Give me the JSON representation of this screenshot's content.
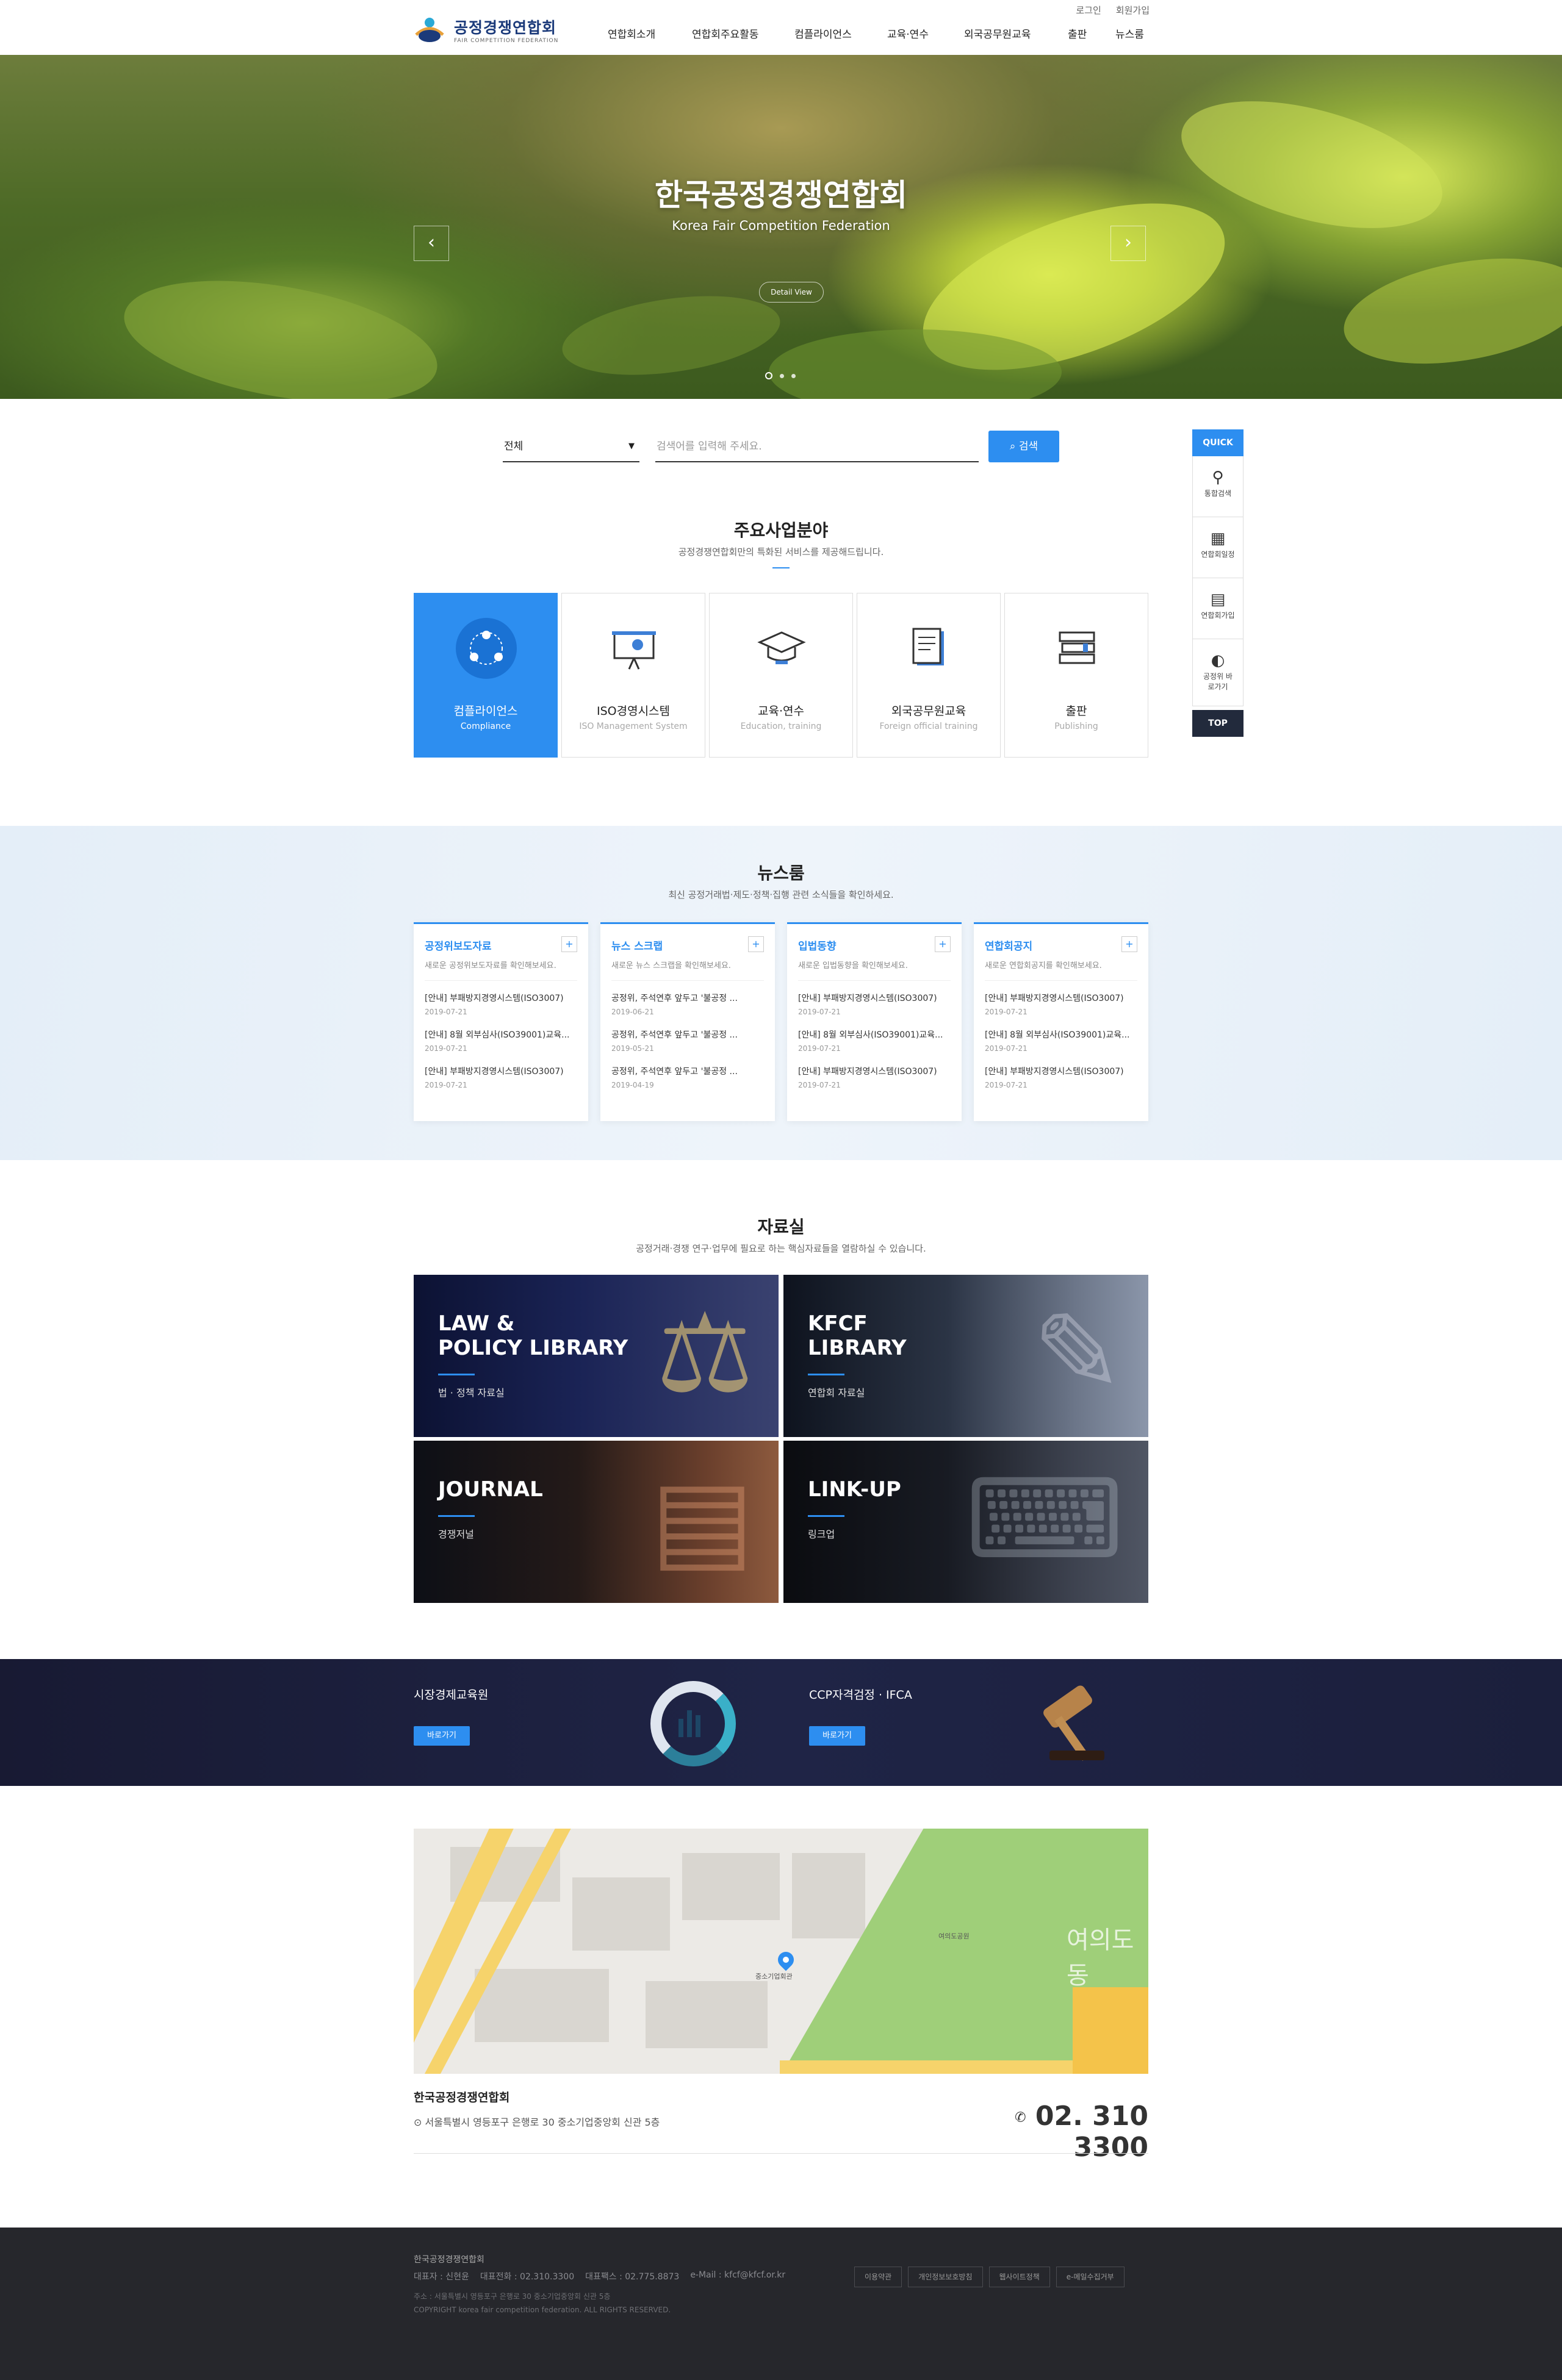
{
  "header": {
    "util": [
      "로그인",
      "회원가입"
    ],
    "logo_ko": "공정경쟁연합회",
    "logo_en": "FAIR COMPETITION FEDERATION",
    "nav": [
      "연합회소개",
      "연합회주요활동",
      "컴플라이언스",
      "교육·연수",
      "외국공무원교육",
      "출판",
      "뉴스룸"
    ]
  },
  "hero": {
    "title": "한국공정경쟁연합회",
    "subtitle": "Korea Fair Competition Federation",
    "button": "Detail View",
    "prev": "‹",
    "next": "›"
  },
  "search": {
    "select_value": "전체",
    "placeholder": "검색어를 입력해 주세요.",
    "button": "검색"
  },
  "quick": {
    "title": "QUICK",
    "items": [
      "통합검색",
      "연합회일정",
      "연합회가입",
      "공정위 바로가기"
    ],
    "top": "TOP"
  },
  "business": {
    "title": "주요사업분야",
    "desc": "공정경쟁연합회만의 특화된 서비스를 제공해드립니다.",
    "cards": [
      {
        "name": "컴플라이언스",
        "en": "Compliance",
        "icon": "people-network-icon"
      },
      {
        "name": "ISO경영시스템",
        "en": "ISO Management System",
        "icon": "presentation-board-icon"
      },
      {
        "name": "교육·연수",
        "en": "Education, training",
        "icon": "graduation-cap-icon"
      },
      {
        "name": "외국공무원교육",
        "en": "Foreign official training",
        "icon": "document-icon"
      },
      {
        "name": "출판",
        "en": "Publishing",
        "icon": "books-icon"
      }
    ]
  },
  "newsroom": {
    "title": "뉴스룸",
    "desc": "최신 공정거래법·제도·정책·집행 관련 소식들을 확인하세요.",
    "cards": [
      {
        "title": "공정위보도자료",
        "desc": "새로운 공정위보도자료를 확인해보세요.",
        "items": [
          {
            "text": "[안내] 부패방지경영시스템(ISO3007)",
            "date": "2019-07-21"
          },
          {
            "text": "[안내] 8월 외부심사(ISO39001)교육...",
            "date": "2019-07-21"
          },
          {
            "text": "[안내] 부패방지경영시스템(ISO3007)",
            "date": "2019-07-21"
          }
        ]
      },
      {
        "title": "뉴스 스크랩",
        "desc": "새로운 뉴스 스크랩을 확인해보세요.",
        "items": [
          {
            "text": "공정위, 주석연후 앞두고 '불공정 ...",
            "date": "2019-06-21"
          },
          {
            "text": "공정위, 주석연후 앞두고 '불공정 ...",
            "date": "2019-05-21"
          },
          {
            "text": "공정위, 주석연후 앞두고 '불공정 ...",
            "date": "2019-04-19"
          }
        ]
      },
      {
        "title": "입법동향",
        "desc": "새로운 입법동향을 확인해보세요.",
        "items": [
          {
            "text": "[안내] 부패방지경영시스템(ISO3007)",
            "date": "2019-07-21"
          },
          {
            "text": "[안내] 8월 외부심사(ISO39001)교육...",
            "date": "2019-07-21"
          },
          {
            "text": "[안내] 부패방지경영시스템(ISO3007)",
            "date": "2019-07-21"
          }
        ]
      },
      {
        "title": "연합회공지",
        "desc": "새로운 연합회공지를 확인해보세요.",
        "items": [
          {
            "text": "[안내] 부패방지경영시스템(ISO3007)",
            "date": "2019-07-21"
          },
          {
            "text": "[안내] 8월 외부심사(ISO39001)교육...",
            "date": "2019-07-21"
          },
          {
            "text": "[안내] 부패방지경영시스템(ISO3007)",
            "date": "2019-07-21"
          }
        ]
      }
    ],
    "plus": "+"
  },
  "library": {
    "title": "자료실",
    "desc": "공정거래·경쟁 연구·업무에 필요로 하는 핵심자료들을 열람하실 수 있습니다.",
    "tiles": [
      {
        "title1": "LAW &",
        "title2": "POLICY LIBRARY",
        "sub": "법 · 정책 자료실"
      },
      {
        "title1": "KFCF",
        "title2": "LIBRARY",
        "sub": "연합회 자료실"
      },
      {
        "title1": "JOURNAL",
        "title2": "",
        "sub": "경쟁저널"
      },
      {
        "title1": "LINK-UP",
        "title2": "",
        "sub": "링크업"
      }
    ]
  },
  "banner": {
    "left_title": "시장경제교육원",
    "right_title": "CCP자격검정 · IFCA",
    "button": "바로가기"
  },
  "location": {
    "name": "한국공정경쟁연합회",
    "address": "서울특별시 영등포구 은행로 30 중소기업중앙회 신관 5층",
    "phone": "02. 310 3300",
    "map_labels": [
      "여의도동",
      "중소기업회관",
      "여의도공원"
    ]
  },
  "footer": {
    "org": "한국공정경쟁연합회",
    "ceo": "대표자 : 신현윤",
    "tel": "대표전화 : 02.310.3300",
    "fax": "대표팩스 : 02.775.8873",
    "email": "e-Mail : kfcf@kfcf.or.kr",
    "address": "주소 : 서울특별시 영등포구 은행로 30 중소기업중앙회 신관 5층",
    "copyright": "COPYRIGHT korea fair competition federation. ALL RIGHTS RESERVED.",
    "links": [
      "이용약관",
      "개인정보보호방침",
      "웹사이트정책",
      "e-메일수집거부"
    ]
  }
}
